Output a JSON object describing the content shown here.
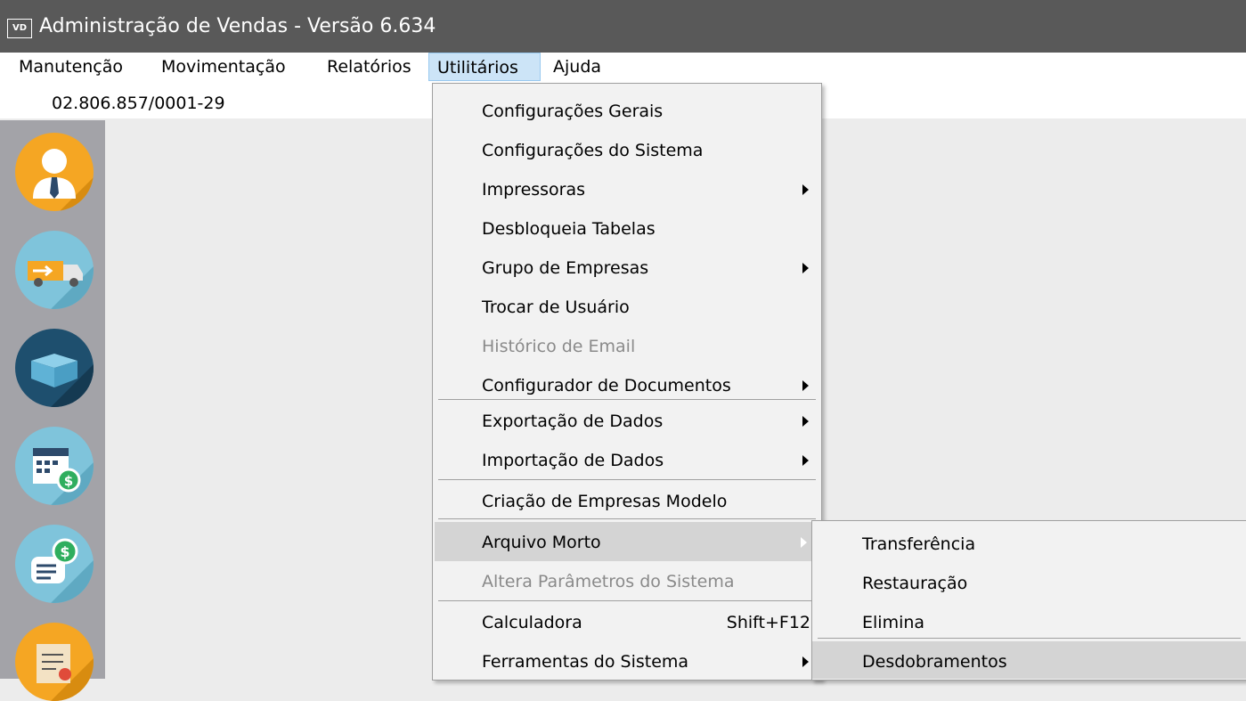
{
  "window": {
    "icon_text": "VD",
    "title": "Administração de Vendas - Versão 6.634"
  },
  "menubar": [
    {
      "label": "Manutenção"
    },
    {
      "label": "Movimentação"
    },
    {
      "label": "Relatórios"
    },
    {
      "label": "Utilitários"
    },
    {
      "label": "Ajuda"
    }
  ],
  "company": {
    "cnpj": "02.806.857/0001-29"
  },
  "sidebar": [
    "user-icon",
    "delivery-truck-icon",
    "box-icon",
    "calendar-money-icon",
    "payment-document-icon",
    "scroll-document-icon"
  ],
  "utilitarios_menu": {
    "items": [
      {
        "label": "Configurações Gerais"
      },
      {
        "label": "Configurações do Sistema"
      },
      {
        "label": "Impressoras"
      },
      {
        "label": "Desbloqueia Tabelas"
      },
      {
        "label": "Grupo de Empresas"
      },
      {
        "label": "Trocar de Usuário"
      },
      {
        "label": "Histórico de Email"
      },
      {
        "label": "Configurador de Documentos"
      },
      {
        "label": "Exportação de Dados"
      },
      {
        "label": "Importação de Dados"
      },
      {
        "label": "Criação de Empresas Modelo"
      },
      {
        "label": "Arquivo Morto"
      },
      {
        "label": "Altera Parâmetros do Sistema"
      },
      {
        "label": "Calculadora",
        "shortcut": "Shift+F12"
      },
      {
        "label": "Ferramentas do Sistema"
      }
    ]
  },
  "arquivo_morto_submenu": {
    "items": [
      {
        "label": "Transferência"
      },
      {
        "label": "Restauração"
      },
      {
        "label": "Elimina"
      },
      {
        "label": "Desdobramentos"
      }
    ]
  },
  "colors": {
    "titlebar": "#595959",
    "sidebar": "#a3a3a8",
    "menu_bg": "#f2f2f2",
    "highlight": "#d4d4d4",
    "menubar_active": "#cce4f7"
  }
}
